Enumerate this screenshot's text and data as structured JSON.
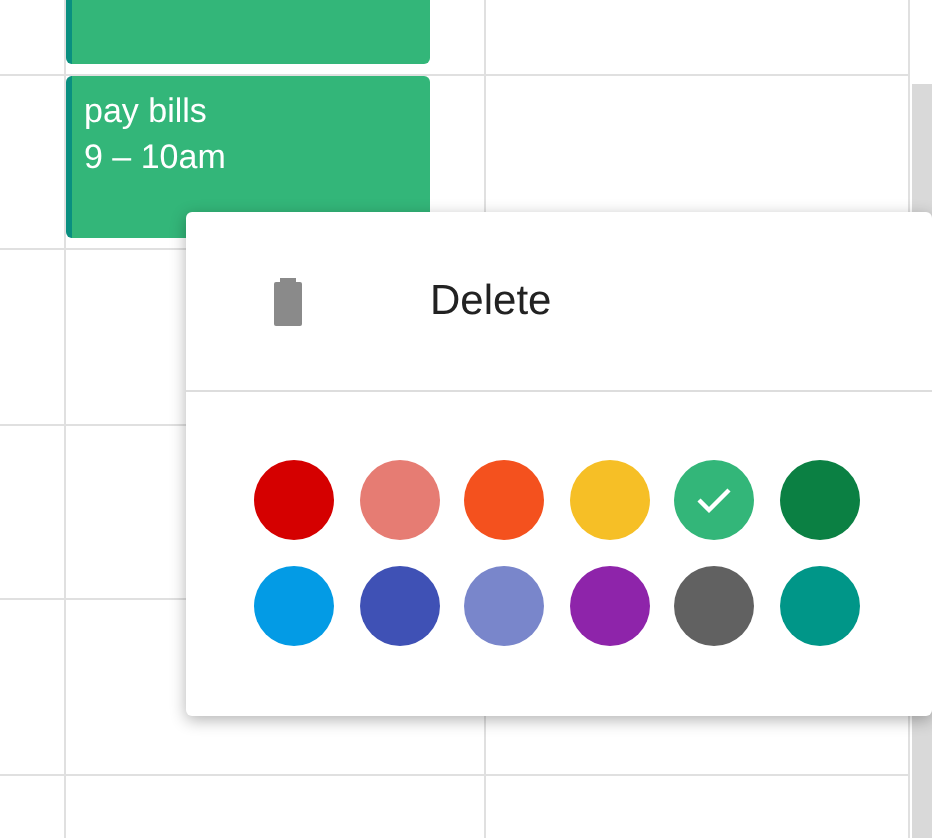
{
  "events": [
    {
      "color": "#33b679"
    },
    {
      "title": "pay bills",
      "time": "9 – 10am",
      "color": "#33b679"
    }
  ],
  "menu": {
    "delete_label": "Delete",
    "colors": [
      {
        "color": "#d50000",
        "selected": false
      },
      {
        "color": "#e67c73",
        "selected": false
      },
      {
        "color": "#f4511e",
        "selected": false
      },
      {
        "color": "#f6bf26",
        "selected": false
      },
      {
        "color": "#33b679",
        "selected": true
      },
      {
        "color": "#0b8043",
        "selected": false
      },
      {
        "color": "#039be5",
        "selected": false
      },
      {
        "color": "#3f51b5",
        "selected": false
      },
      {
        "color": "#7986cb",
        "selected": false
      },
      {
        "color": "#8e24aa",
        "selected": false
      },
      {
        "color": "#616161",
        "selected": false
      },
      {
        "color": "#009688",
        "selected": false
      }
    ]
  }
}
